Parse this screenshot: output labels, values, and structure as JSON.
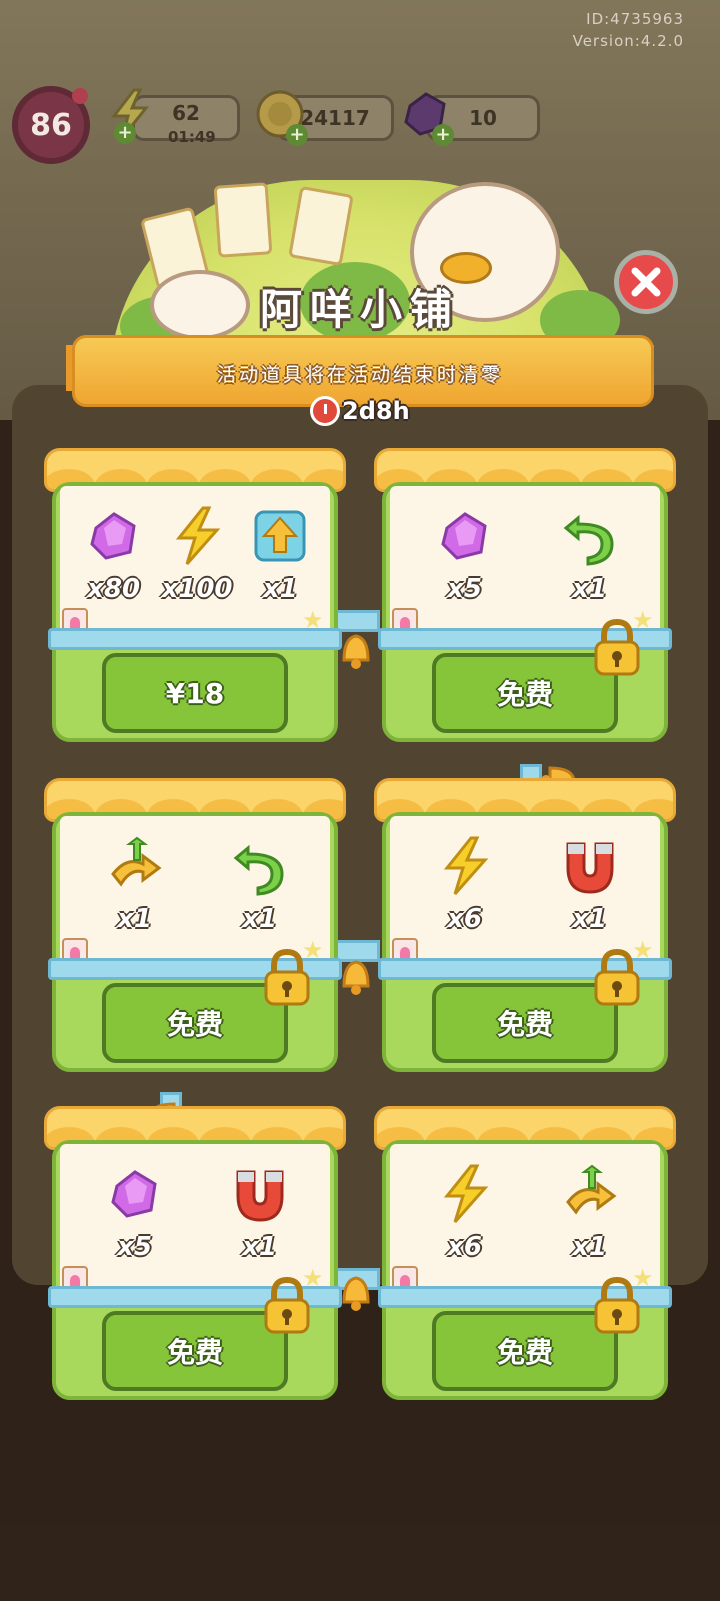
{
  "meta": {
    "id": "ID:4735963",
    "version": "Version:4.2.0"
  },
  "hud": {
    "level": "86",
    "energy": {
      "value": "62",
      "timer": "01:49",
      "icon": "lightning-icon"
    },
    "coins": {
      "value": "24117",
      "icon": "coin-icon"
    },
    "gems": {
      "value": "10",
      "icon": "gem-icon"
    }
  },
  "shop": {
    "title": "阿咩小铺",
    "subtitle": "活动道具将在活动结束时清零",
    "countdown": "2d8h"
  },
  "stalls": [
    {
      "items": [
        {
          "icon": "gem-icon",
          "qty": "x80"
        },
        {
          "icon": "lightning-icon",
          "qty": "x100"
        },
        {
          "icon": "upgrade-arrow-icon",
          "qty": "x1"
        }
      ],
      "button": "¥18",
      "locked": false
    },
    {
      "items": [
        {
          "icon": "gem-icon",
          "qty": "x5"
        },
        {
          "icon": "undo-arrow-icon",
          "qty": "x1"
        }
      ],
      "button": "免费",
      "locked": true
    },
    {
      "items": [
        {
          "icon": "swap-arrow-icon",
          "qty": "x1"
        },
        {
          "icon": "undo-arrow-icon",
          "qty": "x1"
        }
      ],
      "button": "免费",
      "locked": true
    },
    {
      "items": [
        {
          "icon": "lightning-icon",
          "qty": "x6"
        },
        {
          "icon": "magnet-icon",
          "qty": "x1"
        }
      ],
      "button": "免费",
      "locked": true
    },
    {
      "items": [
        {
          "icon": "gem-icon",
          "qty": "x5"
        },
        {
          "icon": "magnet-icon",
          "qty": "x1"
        }
      ],
      "button": "免费",
      "locked": true
    },
    {
      "items": [
        {
          "icon": "lightning-icon",
          "qty": "x6"
        },
        {
          "icon": "swap-arrow-icon",
          "qty": "x1"
        }
      ],
      "button": "免费",
      "locked": true
    }
  ]
}
